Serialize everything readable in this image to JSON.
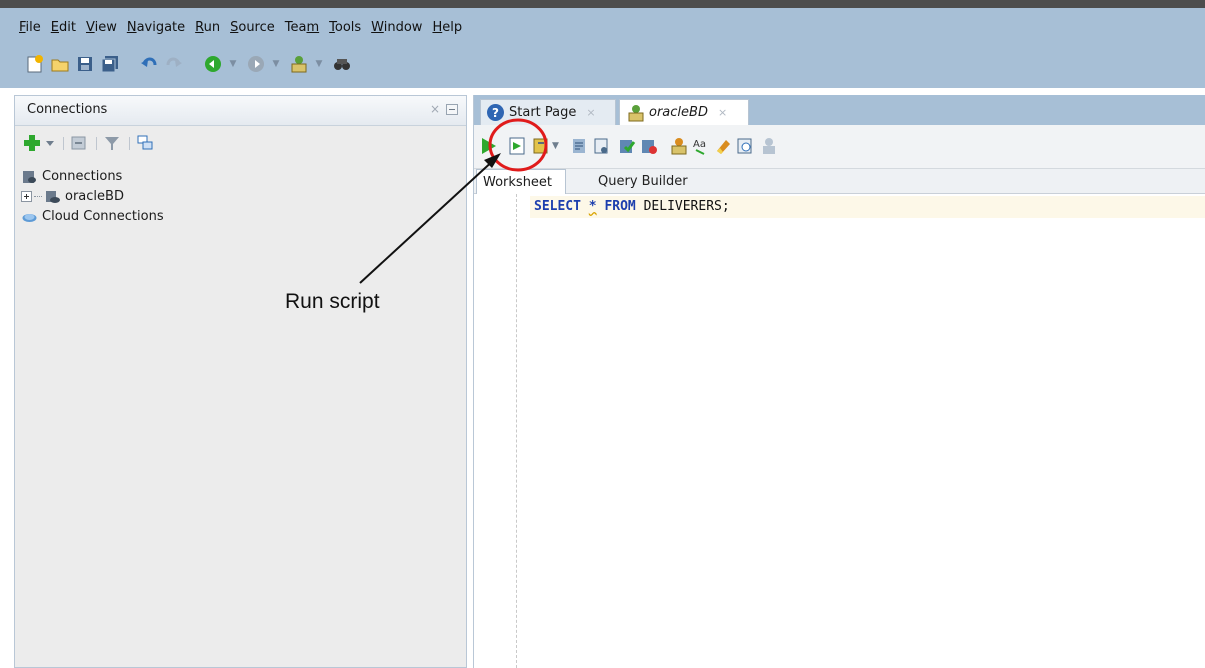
{
  "menubar": {
    "items": [
      {
        "mnemonic": "F",
        "rest": "ile"
      },
      {
        "mnemonic": "E",
        "rest": "dit"
      },
      {
        "mnemonic": "V",
        "rest": "iew"
      },
      {
        "mnemonic": "N",
        "rest": "avigate"
      },
      {
        "mnemonic": "R",
        "rest": "un"
      },
      {
        "mnemonic": "S",
        "rest": "ource"
      },
      {
        "pre": "Tea",
        "mnemonic": "m",
        "rest": ""
      },
      {
        "mnemonic": "T",
        "rest": "ools"
      },
      {
        "mnemonic": "W",
        "rest": "indow"
      },
      {
        "mnemonic": "H",
        "rest": "elp"
      }
    ]
  },
  "toolbar": {
    "icons": [
      "new-file-icon",
      "open-folder-icon",
      "save-icon",
      "save-all-icon",
      "undo-icon",
      "redo-icon",
      "back-icon",
      "forward-icon",
      "sql-worksheet-icon",
      "find-binoculars-icon"
    ]
  },
  "connections_panel": {
    "title": "Connections",
    "close_glyph": "×",
    "tree": {
      "root": "Connections",
      "child": "oracleBD",
      "cloud": "Cloud Connections"
    }
  },
  "editor": {
    "tabs": [
      {
        "label": "Start Page",
        "close": "×"
      },
      {
        "label": "oracleBD",
        "close": "×"
      }
    ],
    "help_glyph": "?",
    "subtabs": [
      "Worksheet",
      "Query Builder"
    ],
    "code": {
      "kw_select": "SELECT",
      "star": "*",
      "kw_from": "FROM",
      "table": "DELIVERERS;"
    }
  },
  "annotation": {
    "label": "Run script",
    "color": "#e01b1b"
  },
  "colors": {
    "chrome": "#a7bfd6",
    "keyword": "#1d3fae",
    "run_green": "#2ea82e"
  }
}
